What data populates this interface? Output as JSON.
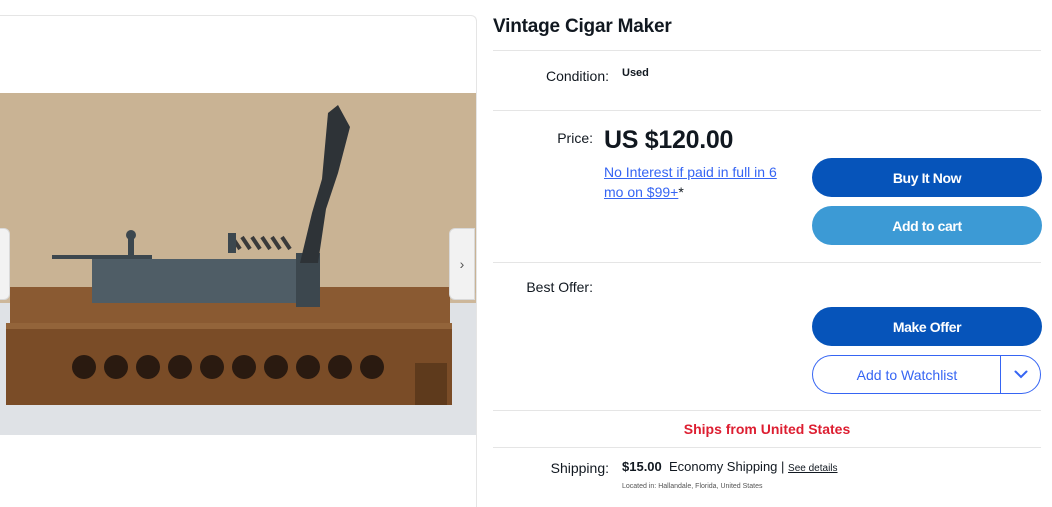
{
  "gallery": {
    "prev_icon": "chevron-left-icon",
    "next_icon": "chevron-right-icon",
    "prev_glyph": "‹",
    "next_glyph": "›"
  },
  "item": {
    "title": "Vintage Cigar Maker",
    "condition_label": "Condition:",
    "condition_value": "Used",
    "price_label": "Price:",
    "price_value": "US $120.00",
    "financing_link": "No Interest if paid in full in 6 mo on $99+",
    "financing_asterisk": "*",
    "best_offer_label": "Best Offer:"
  },
  "actions": {
    "buy_now": "Buy It Now",
    "add_to_cart": "Add to cart",
    "make_offer": "Make Offer",
    "add_to_watchlist": "Add to Watchlist",
    "watchlist_dropdown_icon": "chevron-down-icon"
  },
  "shipping": {
    "ships_from": "Ships from United States",
    "label": "Shipping:",
    "cost": "$15.00",
    "method": "Economy Shipping",
    "separator": "|",
    "see_details": "See details",
    "located_in": "Located in:  Hallandale, Florida, United States"
  },
  "colors": {
    "primary_button": "#0654ba",
    "secondary_button": "#3c9ad5",
    "link": "#3665f3",
    "ships_from_red": "#dd1e31"
  }
}
